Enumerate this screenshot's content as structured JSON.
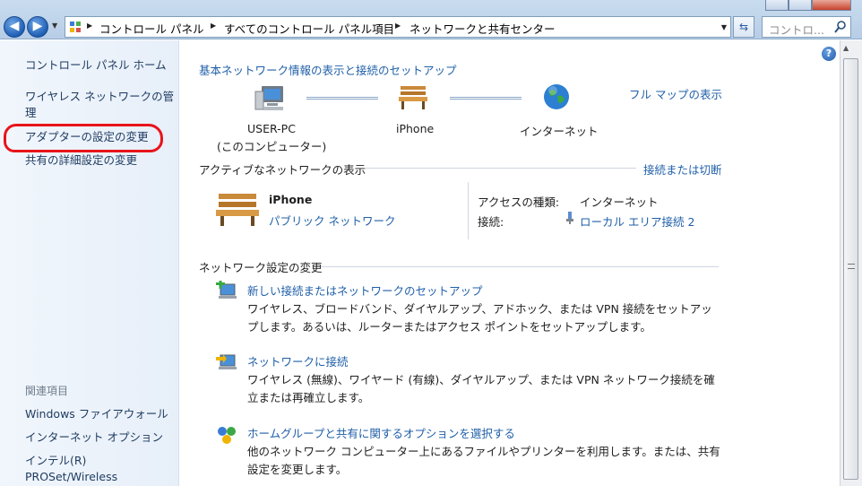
{
  "address_bar": {
    "crumbs": [
      "コントロール パネル",
      "すべてのコントロール パネル項目",
      "ネットワークと共有センター"
    ]
  },
  "search": {
    "placeholder": "コントロ..."
  },
  "sidebar": {
    "items": [
      {
        "label": "コントロール パネル ホーム"
      },
      {
        "label": "ワイヤレス ネットワークの管理"
      },
      {
        "label": "アダプターの設定の変更"
      },
      {
        "label": "共有の詳細設定の変更"
      }
    ],
    "related_heading": "関連項目",
    "related": [
      {
        "label": "Windows ファイアウォール"
      },
      {
        "label": "インターネット オプション"
      },
      {
        "label": "インテル(R) PROSet/Wireless"
      }
    ]
  },
  "main": {
    "title": "基本ネットワーク情報の表示と接続のセットアップ",
    "full_map": "フル マップの表示",
    "map_nodes": [
      {
        "name": "USER-PC",
        "sub": "(このコンピューター)"
      },
      {
        "name": "iPhone",
        "sub": ""
      },
      {
        "name": "インターネット",
        "sub": ""
      }
    ],
    "active_heading": "アクティブなネットワークの表示",
    "connect_disconnect": "接続または切断",
    "active_network": {
      "name": "iPhone",
      "type": "パブリック ネットワーク",
      "access_label": "アクセスの種類:",
      "access_value": "インターネット",
      "conn_label": "接続:",
      "conn_value": "ローカル エリア接続 2"
    },
    "settings_heading": "ネットワーク設定の変更",
    "tasks": [
      {
        "title": "新しい接続またはネットワークのセットアップ",
        "desc": "ワイヤレス、ブロードバンド、ダイヤルアップ、アドホック、または VPN 接続をセットアップします。あるいは、ルーターまたはアクセス ポイントをセットアップします。"
      },
      {
        "title": "ネットワークに接続",
        "desc": "ワイヤレス (無線)、ワイヤード (有線)、ダイヤルアップ、または VPN ネットワーク接続を確立または再確立します。"
      },
      {
        "title": "ホームグループと共有に関するオプションを選択する",
        "desc": "他のネットワーク コンピューター上にあるファイルやプリンターを利用します。または、共有設定を変更します。"
      }
    ]
  }
}
